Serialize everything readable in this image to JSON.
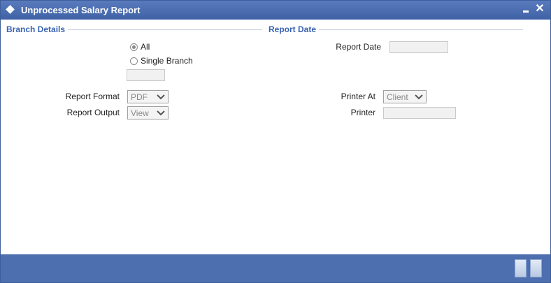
{
  "window": {
    "title": "Unprocessed Salary Report",
    "minimize_icon": "minimize-icon",
    "close_symbol": "✕"
  },
  "branch_details": {
    "header": "Branch Details",
    "all_label": "All",
    "all_selected": true,
    "single_branch_label": "Single Branch",
    "single_branch_selected": false,
    "branch_value": ""
  },
  "report_date": {
    "header": "Report Date",
    "label": "Report Date",
    "value": ""
  },
  "report_format": {
    "label": "Report Format",
    "value": "PDF"
  },
  "report_output": {
    "label": "Report Output",
    "value": "View"
  },
  "printer_at": {
    "label": "Printer At",
    "value": "Client"
  },
  "printer": {
    "label": "Printer",
    "value": ""
  },
  "colors": {
    "titlebar": "#4a6db0",
    "section_header": "#3a63b0",
    "footer": "#4d6fb0"
  }
}
